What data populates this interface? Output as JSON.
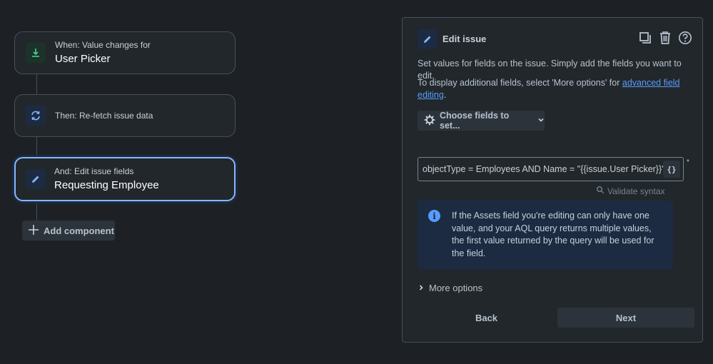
{
  "flow": {
    "trigger": {
      "sub": "When: Value changes for",
      "main": "User Picker",
      "icon": "field-change-icon"
    },
    "action_refetch": {
      "sub": "Then: Re-fetch issue data",
      "icon": "refresh-icon"
    },
    "action_edit": {
      "sub": "And: Edit issue fields",
      "main": "Requesting Employee",
      "icon": "pencil-icon"
    },
    "add_component_label": "Add component"
  },
  "panel": {
    "title": "Edit issue",
    "description": "Set values for fields on the issue. Simply add the fields you want to edit.",
    "additional_prefix": "To display additional fields, select 'More options' for",
    "additional_link": "advanced field editing",
    "additional_suffix": ".",
    "choose_fields_label": "Choose fields to set...",
    "aql_value": "objectType = Employees AND Name = \"{{issue.User Picker}}\"",
    "braces_label": "{}",
    "required_marker": "*",
    "validate_label": "Validate syntax",
    "info_text": "If the Assets field you're editing can only have one value, and your AQL query returns multiple values, the first value returned by the query will be used for the field.",
    "more_options_label": "More options",
    "back_label": "Back",
    "next_label": "Next"
  },
  "colors": {
    "background": "#1d2125",
    "surface": "#22272b",
    "accent": "#579dff",
    "selected_border": "#85b8ff",
    "info_bg": "#1c2b41",
    "trigger_icon": "#4bce97"
  }
}
